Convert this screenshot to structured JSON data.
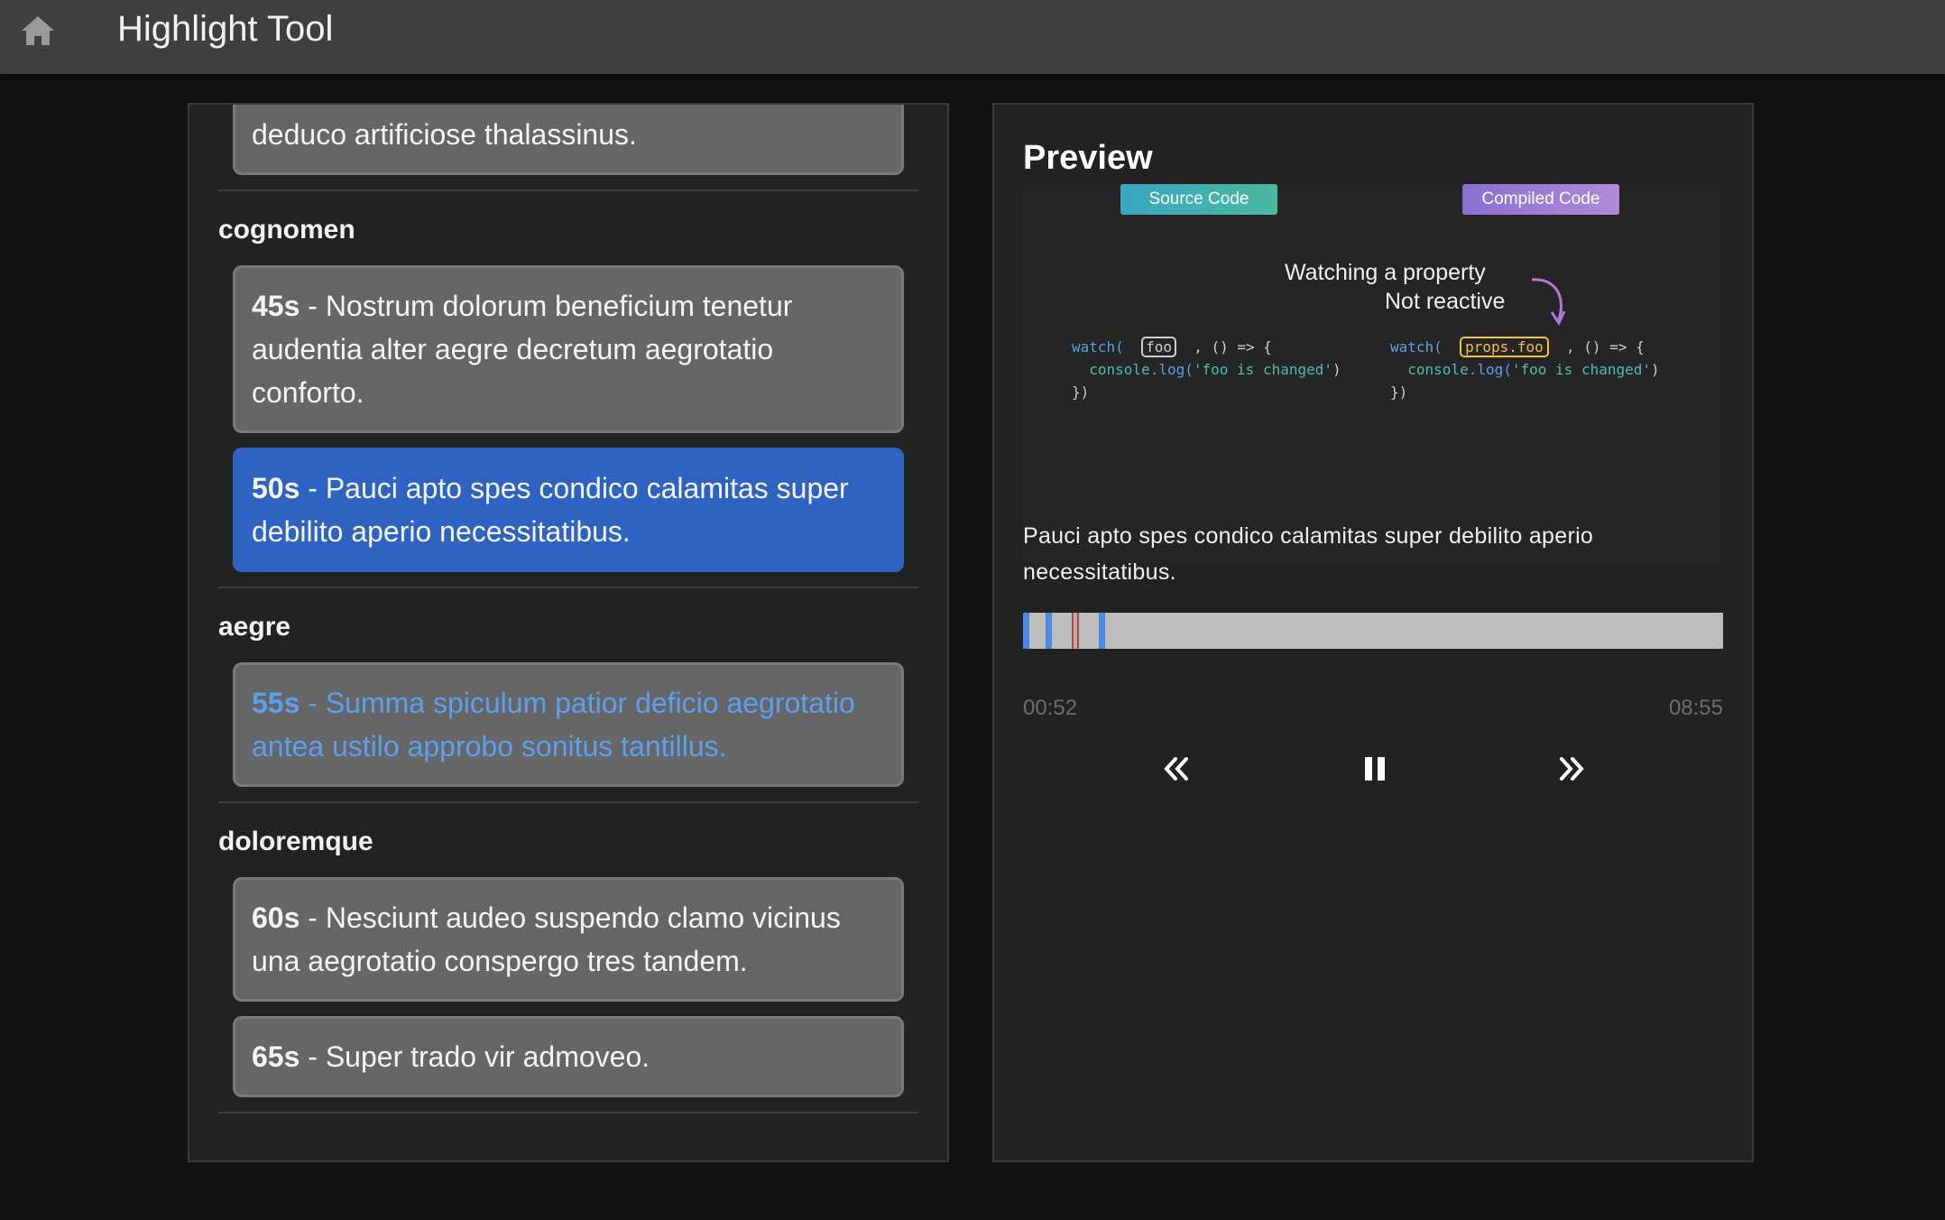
{
  "app": {
    "title": "Highlight Tool",
    "home_icon": "home-icon"
  },
  "segments_panel": {
    "top_partial_text": "deduco artificiose thalassinus.",
    "groups": [
      {
        "title": "cognomen",
        "items": [
          {
            "time": "45s",
            "sep": " - ",
            "text": "Nostrum dolorum beneficium tenetur audentia alter aegre decretum aegrotatio conforto.",
            "state": "normal"
          },
          {
            "time": "50s",
            "sep": " - ",
            "text": "Pauci apto spes condico calamitas super debilito aperio necessitatibus.",
            "state": "active"
          }
        ]
      },
      {
        "title": "aegre",
        "items": [
          {
            "time": "55s",
            "sep": " - ",
            "text": "Summa spiculum patior deficio aegrotatio antea ustilo approbo sonitus tantillus.",
            "state": "link"
          }
        ]
      },
      {
        "title": "doloremque",
        "items": [
          {
            "time": "60s",
            "sep": " - ",
            "text": "Nesciunt audeo suspendo clamo vicinus una aegrotatio conspergo tres tandem.",
            "state": "normal"
          },
          {
            "time": "65s",
            "sep": " - ",
            "text": "Super trado vir admoveo.",
            "state": "normal"
          }
        ]
      }
    ]
  },
  "preview": {
    "title": "Preview",
    "image": {
      "badge_left": "Source Code",
      "badge_right": "Compiled Code",
      "annotation_1": "Watching a property",
      "annotation_2": "Not reactive",
      "left_code": {
        "fn": "watch(",
        "arg": "foo",
        "rest": ", () => {",
        "line2_prefix": "console",
        "line2_method": ".log(",
        "line2_str": "'foo is changed'",
        "line2_end": ")",
        "line3": "})"
      },
      "right_code": {
        "fn": "watch(",
        "arg": "props.foo",
        "rest": ", () => {",
        "line2_prefix": "console",
        "line2_method": ".log(",
        "line2_str": "'foo is changed'",
        "line2_end": ")",
        "line3": "})"
      }
    },
    "caption": "Pauci apto spes condico calamitas super debilito aperio necessitatibus.",
    "player": {
      "current_time": "00:52",
      "duration": "08:55",
      "progress_fraction": 0.1,
      "highlight_marks_fraction": [
        0.0,
        0.032,
        0.108
      ],
      "controls": [
        "rewind-icon",
        "pause-icon",
        "fast-forward-icon"
      ]
    }
  },
  "colors": {
    "topbar": "#3f3f3f",
    "background": "#121212",
    "panel": "#222222",
    "card": "#666666",
    "active_card": "#2f63c1",
    "link_text": "#5aa0ef",
    "progress_track": "#bdbdbd",
    "highlight_mark": "#4a8ae6",
    "playhead": "#c04444"
  }
}
